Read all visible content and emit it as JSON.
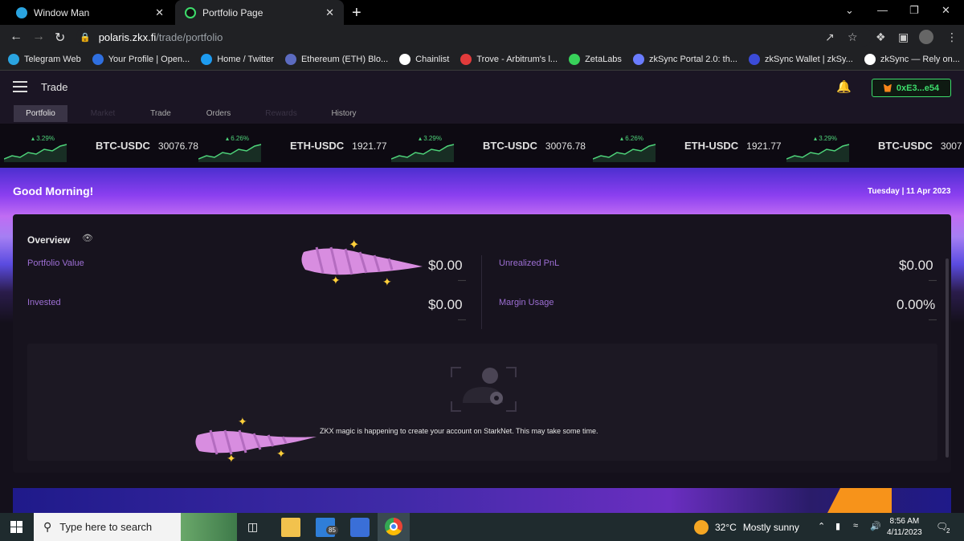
{
  "browser": {
    "tabs": [
      {
        "title": "Window Man",
        "close": "✕"
      },
      {
        "title": "Portfolio Page",
        "close": "✕"
      }
    ],
    "new_tab": "+",
    "window": {
      "minimize": "⌄",
      "restore": "—",
      "maximize": "❐",
      "close": "✕"
    },
    "url": {
      "host": "polaris.zkx.fi",
      "path": "/trade/portfolio"
    },
    "bookmarks": [
      {
        "label": "Telegram Web",
        "color": "#2aa4e0"
      },
      {
        "label": "Your Profile | Open...",
        "color": "#2f6fe0"
      },
      {
        "label": "Home / Twitter",
        "color": "#1d9bf0"
      },
      {
        "label": "Ethereum (ETH) Blo...",
        "color": "#5c6bc0"
      },
      {
        "label": "Chainlist",
        "color": "#ffffff"
      },
      {
        "label": "Trove - Arbitrum's l...",
        "color": "#e23b3b"
      },
      {
        "label": "ZetaLabs",
        "color": "#38d15a"
      },
      {
        "label": "zkSync Portal 2.0: th...",
        "color": "#6a7cff"
      },
      {
        "label": "zkSync Wallet | zkSy...",
        "color": "#3b4bd8"
      },
      {
        "label": "zkSync — Rely on...",
        "color": "#ffffff"
      }
    ]
  },
  "app": {
    "title": "Trade",
    "wallet": "0xE3...e54",
    "nav": [
      "Portfolio",
      "Market",
      "Trade",
      "Orders",
      "Rewards",
      "History"
    ],
    "ticker": [
      {
        "pair": "BTC-USDC",
        "price": "30076.78",
        "change": "3.29%"
      },
      {
        "pair": "ETH-USDC",
        "price": "1921.77",
        "change": "6.26%"
      },
      {
        "pair": "BTC-USDC",
        "price": "30076.78",
        "change": "3.29%"
      },
      {
        "pair": "ETH-USDC",
        "price": "1921.77",
        "change": "6.26%"
      },
      {
        "pair": "BTC-USDC",
        "price": "3007",
        "change": "3.29%"
      }
    ],
    "greeting": "Good Morning!",
    "date": "Tuesday | 11 Apr 2023",
    "overview": {
      "title": "Overview",
      "portfolio_value": {
        "label": "Portfolio Value",
        "value": "$0.00"
      },
      "unrealized_pnl": {
        "label": "Unrealized PnL",
        "value": "$0.00"
      },
      "invested": {
        "label": "Invested",
        "value": "$0.00"
      },
      "margin_usage": {
        "label": "Margin Usage",
        "value": "0.00%"
      },
      "dash": "—"
    },
    "message": "ZKX magic is happening to create your account on StarkNet. This may take some time."
  },
  "taskbar": {
    "search_placeholder": "Type here to search",
    "mail_badge": "85",
    "weather": {
      "temp": "32°C",
      "text": "Mostly sunny"
    },
    "time": "8:56 AM",
    "date": "4/11/2023",
    "notifications": "2"
  }
}
